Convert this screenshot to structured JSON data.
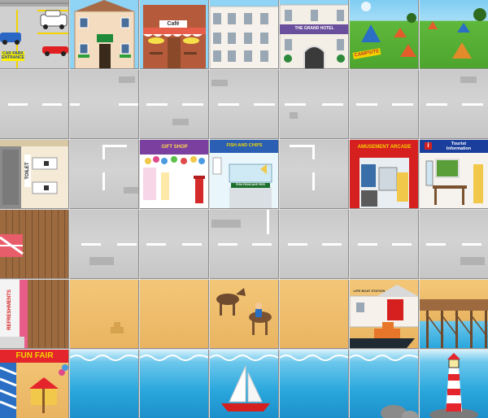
{
  "board": {
    "columns": 7,
    "rows": 6,
    "tiles": [
      [
        "car-park",
        "guest-house",
        "cafe",
        "terraces",
        "grand-hotel",
        "campsite",
        "field"
      ],
      [
        "road-horizontal",
        "road-horizontal",
        "road-horizontal",
        "road-horizontal",
        "road-horizontal",
        "road-horizontal",
        "road-horizontal"
      ],
      [
        "toilet",
        "road-corner",
        "gift-shop",
        "fish-and-chips",
        "road-corner",
        "amusement-arcade",
        "tourist-information"
      ],
      [
        "pier-boards",
        "road-horizontal",
        "road-horizontal",
        "road-junction",
        "road-horizontal",
        "road-horizontal",
        "road-horizontal"
      ],
      [
        "pier-refreshments",
        "beach",
        "beach",
        "beach-donkeys",
        "beach",
        "lifeboat-station",
        "pier-legs"
      ],
      [
        "fun-fair",
        "sea",
        "sea",
        "sea-sailboat",
        "sea",
        "sea-rocks",
        "sea-lighthouse"
      ]
    ]
  },
  "signs": {
    "car_park": "CAR PARK\nENTRANCE",
    "cafe": "Café",
    "grand_hotel": "THE GRAND HOTEL",
    "campsite": "CAMPSITE",
    "toilet": "TOILET",
    "gift_shop": "GIFT SHOP",
    "fish_and_chips": "FISH AND CHIPS",
    "fish_prices": "FISH  FISHCAKE  PIES",
    "amusement_arcade": "AMUSEMENT ARCADE",
    "tourist_info": "Tourist\nInformation",
    "tourist_info_symbol": "i",
    "refreshments": "REFRESHMENTS",
    "lifeboat_station": "LIFE BOAT STATION",
    "fun_fair": "FUN FAIR"
  },
  "colors": {
    "road": "#c9c9c9",
    "road_marking": "#ffffff",
    "sand": "#f0c270",
    "sea": "#2aa7dc",
    "grass": "#5fb83a",
    "sky": "#8fd3f5",
    "arcade_red": "#d62020",
    "hotel_purple": "#6a4f9c",
    "fun_fair_red": "#e4262c"
  }
}
